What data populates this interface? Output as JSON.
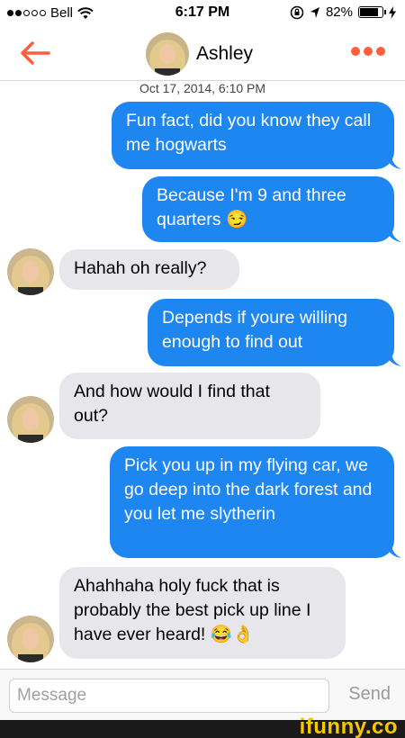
{
  "status_bar": {
    "carrier": "Bell",
    "time": "6:17 PM",
    "battery_percent": "82%",
    "battery_level": 0.82,
    "icons": [
      "signal-dots-icon",
      "wifi-icon",
      "lock-rotation-icon",
      "location-icon",
      "battery-icon",
      "charging-icon"
    ]
  },
  "header": {
    "contact_name": "Ashley",
    "back_icon": "arrow-left-icon",
    "more_icon": "more-dots-icon",
    "accent_color": "#fd5e3c"
  },
  "conversation": {
    "timestamp": "Oct 17, 2014, 6:10 PM",
    "messages": [
      {
        "from": "me",
        "text": "Fun fact, did you know they call me hogwarts"
      },
      {
        "from": "me",
        "text": "Because I'm 9 and three quarters 😏"
      },
      {
        "from": "them",
        "text": "Hahah oh really?"
      },
      {
        "from": "me",
        "text": "Depends if youre willing enough to find out"
      },
      {
        "from": "them",
        "text": "And how would I find that out?"
      },
      {
        "from": "me",
        "text": "Pick you up in my flying car, we go deep into the dark forest and you let me slytherin"
      },
      {
        "from": "them",
        "text": "Ahahhaha holy fuck that is probably the best pick up line I have ever heard! 😂👌"
      }
    ],
    "outgoing_color": "#1e86f0",
    "incoming_color": "#e6e6eb"
  },
  "composer": {
    "placeholder": "Message",
    "send_label": "Send"
  },
  "watermark": "ifunny.co"
}
